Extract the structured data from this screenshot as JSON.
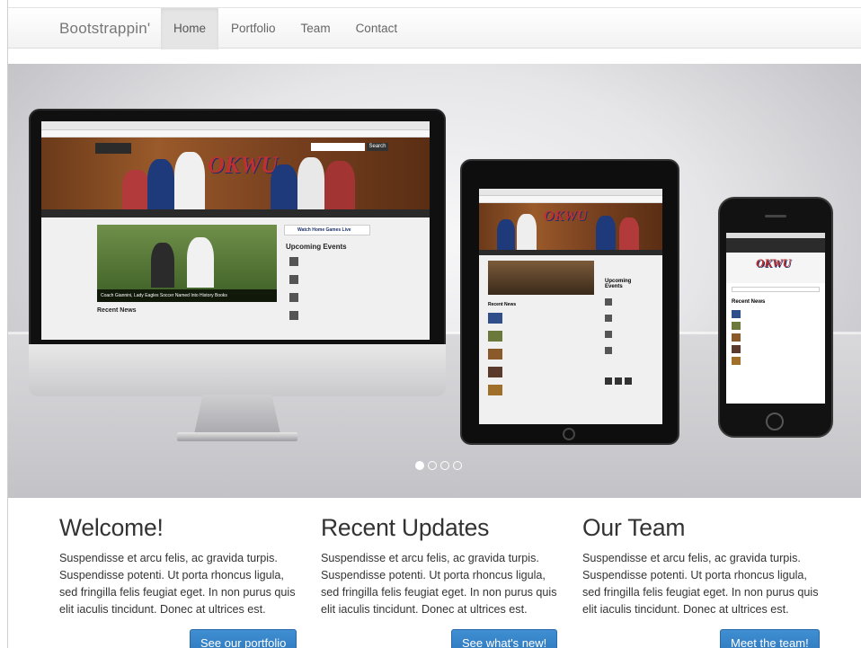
{
  "navbar": {
    "brand": "Bootstrappin'",
    "items": [
      {
        "label": "Home",
        "active": true
      },
      {
        "label": "Portfolio"
      },
      {
        "label": "Team"
      },
      {
        "label": "Contact"
      }
    ]
  },
  "carousel": {
    "slide_count": 4,
    "active_slide": 1,
    "mini_site": {
      "logo": "OKWU",
      "search_button": "Search",
      "featured_caption": "Coach Giannini, Lady Eagles Soccer Named Into History Books",
      "recent_news": "Recent News",
      "upcoming_events": "Upcoming Events",
      "watch_games": "Watch Home Games Live"
    }
  },
  "columns": [
    {
      "heading": "Welcome!",
      "text": "Suspendisse et arcu felis, ac gravida turpis. Suspendisse potenti. Ut porta rhoncus ligula, sed fringilla felis feugiat eget. In non purus quis elit iaculis tincidunt. Donec at ultrices est.",
      "button": "See our portfolio"
    },
    {
      "heading": "Recent Updates",
      "text": "Suspendisse et arcu felis, ac gravida turpis. Suspendisse potenti. Ut porta rhoncus ligula, sed fringilla felis feugiat eget. In non purus quis elit iaculis tincidunt. Donec at ultrices est.",
      "button": "See what's new!"
    },
    {
      "heading": "Our Team",
      "text": "Suspendisse et arcu felis, ac gravida turpis. Suspendisse potenti. Ut porta rhoncus ligula, sed fringilla felis feugiat eget. In non purus quis elit iaculis tincidunt. Donec at ultrices est.",
      "button": "Meet the team!"
    }
  ],
  "colors": {
    "button_primary": "#3680c6",
    "navbar_active": "#e5e5e5",
    "okwu_red": "#c03030",
    "okwu_blue": "#1c2f6a"
  }
}
